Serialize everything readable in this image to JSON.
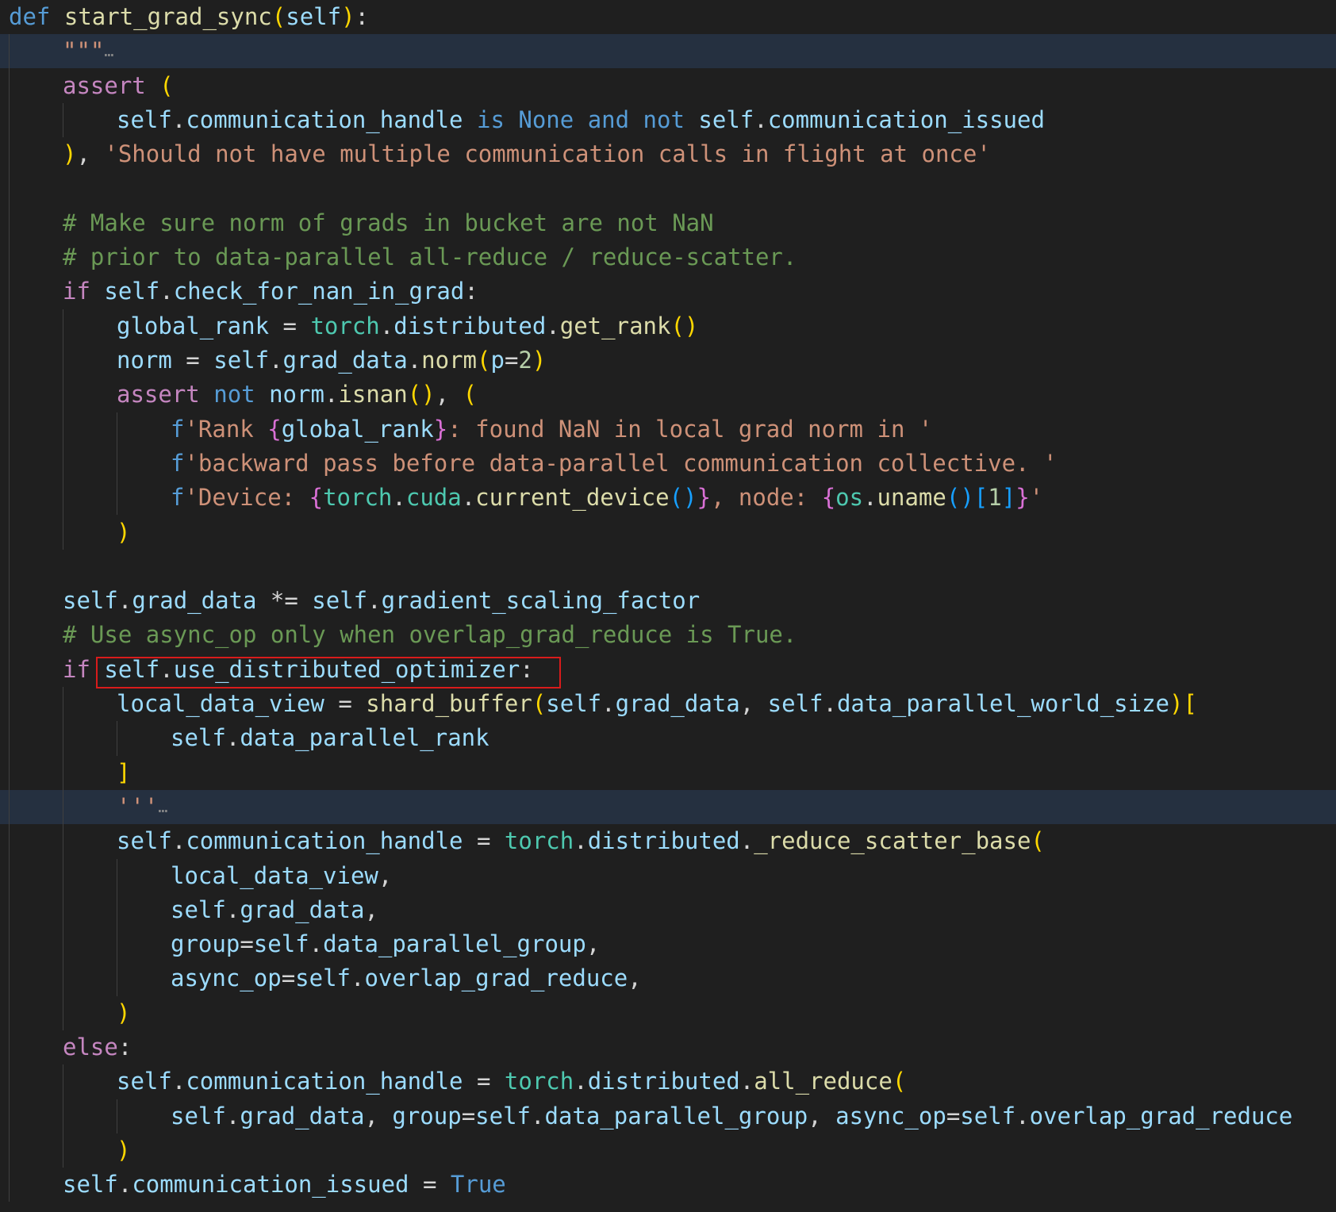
{
  "colors": {
    "background": "#1f1f1f",
    "folded_line": "#253040",
    "indent_guide": "#404040",
    "highlight_box": "#d81b1b",
    "k": "#569cd6",
    "c": "#c586c0",
    "f": "#dcdcaa",
    "v": "#9cdcfe",
    "s": "#ce9178",
    "m": "#6a9955",
    "t": "#4ec9b0",
    "n": "#b5cea8",
    "o": "#d4d4d4",
    "p1": "#ffd700",
    "p2": "#da70d6",
    "p3": "#179fff",
    "x": "#8a8a8a"
  },
  "code_lines": [
    {
      "indent": 0,
      "tokens": [
        [
          "k",
          "def"
        ],
        [
          "o",
          " "
        ],
        [
          "f",
          "start_grad_sync"
        ],
        [
          "p1",
          "("
        ],
        [
          "v",
          "self"
        ],
        [
          "p1",
          ")"
        ],
        [
          "o",
          ":"
        ]
      ]
    },
    {
      "indent": 1,
      "folded": true,
      "tokens": [
        [
          "s",
          "\"\"\""
        ],
        [
          "x",
          "…"
        ]
      ]
    },
    {
      "indent": 1,
      "tokens": [
        [
          "c",
          "assert"
        ],
        [
          "o",
          " "
        ],
        [
          "p1",
          "("
        ]
      ]
    },
    {
      "indent": 2,
      "tokens": [
        [
          "v",
          "self"
        ],
        [
          "o",
          "."
        ],
        [
          "v",
          "communication_handle"
        ],
        [
          "o",
          " "
        ],
        [
          "k",
          "is"
        ],
        [
          "o",
          " "
        ],
        [
          "k",
          "None"
        ],
        [
          "o",
          " "
        ],
        [
          "k",
          "and"
        ],
        [
          "o",
          " "
        ],
        [
          "k",
          "not"
        ],
        [
          "o",
          " "
        ],
        [
          "v",
          "self"
        ],
        [
          "o",
          "."
        ],
        [
          "v",
          "communication_issued"
        ]
      ]
    },
    {
      "indent": 1,
      "tokens": [
        [
          "p1",
          ")"
        ],
        [
          "o",
          ", "
        ],
        [
          "s",
          "'Should not have multiple communication calls in flight at once'"
        ]
      ]
    },
    {
      "indent": 0,
      "tokens": []
    },
    {
      "indent": 1,
      "tokens": [
        [
          "m",
          "# Make sure norm of grads in bucket are not NaN"
        ]
      ]
    },
    {
      "indent": 1,
      "tokens": [
        [
          "m",
          "# prior to data-parallel all-reduce / reduce-scatter."
        ]
      ]
    },
    {
      "indent": 1,
      "tokens": [
        [
          "c",
          "if"
        ],
        [
          "o",
          " "
        ],
        [
          "v",
          "self"
        ],
        [
          "o",
          "."
        ],
        [
          "v",
          "check_for_nan_in_grad"
        ],
        [
          "o",
          ":"
        ]
      ]
    },
    {
      "indent": 2,
      "tokens": [
        [
          "v",
          "global_rank"
        ],
        [
          "o",
          " = "
        ],
        [
          "t",
          "torch"
        ],
        [
          "o",
          "."
        ],
        [
          "v",
          "distributed"
        ],
        [
          "o",
          "."
        ],
        [
          "f",
          "get_rank"
        ],
        [
          "p1",
          "()"
        ]
      ]
    },
    {
      "indent": 2,
      "tokens": [
        [
          "v",
          "norm"
        ],
        [
          "o",
          " = "
        ],
        [
          "v",
          "self"
        ],
        [
          "o",
          "."
        ],
        [
          "v",
          "grad_data"
        ],
        [
          "o",
          "."
        ],
        [
          "f",
          "norm"
        ],
        [
          "p1",
          "("
        ],
        [
          "v",
          "p"
        ],
        [
          "o",
          "="
        ],
        [
          "n",
          "2"
        ],
        [
          "p1",
          ")"
        ]
      ]
    },
    {
      "indent": 2,
      "tokens": [
        [
          "c",
          "assert"
        ],
        [
          "o",
          " "
        ],
        [
          "k",
          "not"
        ],
        [
          "o",
          " "
        ],
        [
          "v",
          "norm"
        ],
        [
          "o",
          "."
        ],
        [
          "f",
          "isnan"
        ],
        [
          "p1",
          "()"
        ],
        [
          "o",
          ", "
        ],
        [
          "p1",
          "("
        ]
      ]
    },
    {
      "indent": 3,
      "tokens": [
        [
          "k",
          "f"
        ],
        [
          "s",
          "'Rank "
        ],
        [
          "p2",
          "{"
        ],
        [
          "v",
          "global_rank"
        ],
        [
          "p2",
          "}"
        ],
        [
          "s",
          ": found NaN in local grad norm in '"
        ]
      ]
    },
    {
      "indent": 3,
      "tokens": [
        [
          "k",
          "f"
        ],
        [
          "s",
          "'backward pass before data-parallel communication collective. '"
        ]
      ]
    },
    {
      "indent": 3,
      "tokens": [
        [
          "k",
          "f"
        ],
        [
          "s",
          "'Device: "
        ],
        [
          "p2",
          "{"
        ],
        [
          "t",
          "torch"
        ],
        [
          "o",
          "."
        ],
        [
          "t",
          "cuda"
        ],
        [
          "o",
          "."
        ],
        [
          "f",
          "current_device"
        ],
        [
          "p3",
          "()"
        ],
        [
          "p2",
          "}"
        ],
        [
          "s",
          ", node: "
        ],
        [
          "p2",
          "{"
        ],
        [
          "t",
          "os"
        ],
        [
          "o",
          "."
        ],
        [
          "f",
          "uname"
        ],
        [
          "p3",
          "()"
        ],
        [
          "p3",
          "["
        ],
        [
          "n",
          "1"
        ],
        [
          "p3",
          "]"
        ],
        [
          "p2",
          "}"
        ],
        [
          "s",
          "'"
        ]
      ]
    },
    {
      "indent": 2,
      "tokens": [
        [
          "p1",
          ")"
        ]
      ]
    },
    {
      "indent": 0,
      "tokens": []
    },
    {
      "indent": 1,
      "tokens": [
        [
          "v",
          "self"
        ],
        [
          "o",
          "."
        ],
        [
          "v",
          "grad_data"
        ],
        [
          "o",
          " *= "
        ],
        [
          "v",
          "self"
        ],
        [
          "o",
          "."
        ],
        [
          "v",
          "gradient_scaling_factor"
        ]
      ]
    },
    {
      "indent": 1,
      "tokens": [
        [
          "m",
          "# Use async_op only when overlap_grad_reduce is True."
        ]
      ]
    },
    {
      "indent": 1,
      "tokens": [
        [
          "c",
          "if"
        ],
        [
          "o",
          " "
        ],
        [
          "v",
          "self"
        ],
        [
          "o",
          "."
        ],
        [
          "v",
          "use_distributed_optimizer"
        ],
        [
          "o",
          ":"
        ]
      ]
    },
    {
      "indent": 2,
      "tokens": [
        [
          "v",
          "local_data_view"
        ],
        [
          "o",
          " = "
        ],
        [
          "f",
          "shard_buffer"
        ],
        [
          "p1",
          "("
        ],
        [
          "v",
          "self"
        ],
        [
          "o",
          "."
        ],
        [
          "v",
          "grad_data"
        ],
        [
          "o",
          ", "
        ],
        [
          "v",
          "self"
        ],
        [
          "o",
          "."
        ],
        [
          "v",
          "data_parallel_world_size"
        ],
        [
          "p1",
          ")"
        ],
        [
          "p1",
          "["
        ]
      ]
    },
    {
      "indent": 3,
      "tokens": [
        [
          "v",
          "self"
        ],
        [
          "o",
          "."
        ],
        [
          "v",
          "data_parallel_rank"
        ]
      ]
    },
    {
      "indent": 2,
      "tokens": [
        [
          "p1",
          "]"
        ]
      ]
    },
    {
      "indent": 2,
      "folded": true,
      "tokens": [
        [
          "s",
          "'''"
        ],
        [
          "x",
          "…"
        ]
      ]
    },
    {
      "indent": 2,
      "tokens": [
        [
          "v",
          "self"
        ],
        [
          "o",
          "."
        ],
        [
          "v",
          "communication_handle"
        ],
        [
          "o",
          " = "
        ],
        [
          "t",
          "torch"
        ],
        [
          "o",
          "."
        ],
        [
          "v",
          "distributed"
        ],
        [
          "o",
          "."
        ],
        [
          "f",
          "_reduce_scatter_base"
        ],
        [
          "p1",
          "("
        ]
      ]
    },
    {
      "indent": 3,
      "tokens": [
        [
          "v",
          "local_data_view"
        ],
        [
          "o",
          ","
        ]
      ]
    },
    {
      "indent": 3,
      "tokens": [
        [
          "v",
          "self"
        ],
        [
          "o",
          "."
        ],
        [
          "v",
          "grad_data"
        ],
        [
          "o",
          ","
        ]
      ]
    },
    {
      "indent": 3,
      "tokens": [
        [
          "v",
          "group"
        ],
        [
          "o",
          "="
        ],
        [
          "v",
          "self"
        ],
        [
          "o",
          "."
        ],
        [
          "v",
          "data_parallel_group"
        ],
        [
          "o",
          ","
        ]
      ]
    },
    {
      "indent": 3,
      "tokens": [
        [
          "v",
          "async_op"
        ],
        [
          "o",
          "="
        ],
        [
          "v",
          "self"
        ],
        [
          "o",
          "."
        ],
        [
          "v",
          "overlap_grad_reduce"
        ],
        [
          "o",
          ","
        ]
      ]
    },
    {
      "indent": 2,
      "tokens": [
        [
          "p1",
          ")"
        ]
      ]
    },
    {
      "indent": 1,
      "tokens": [
        [
          "c",
          "else"
        ],
        [
          "o",
          ":"
        ]
      ]
    },
    {
      "indent": 2,
      "tokens": [
        [
          "v",
          "self"
        ],
        [
          "o",
          "."
        ],
        [
          "v",
          "communication_handle"
        ],
        [
          "o",
          " = "
        ],
        [
          "t",
          "torch"
        ],
        [
          "o",
          "."
        ],
        [
          "v",
          "distributed"
        ],
        [
          "o",
          "."
        ],
        [
          "f",
          "all_reduce"
        ],
        [
          "p1",
          "("
        ]
      ]
    },
    {
      "indent": 3,
      "tokens": [
        [
          "v",
          "self"
        ],
        [
          "o",
          "."
        ],
        [
          "v",
          "grad_data"
        ],
        [
          "o",
          ", "
        ],
        [
          "v",
          "group"
        ],
        [
          "o",
          "="
        ],
        [
          "v",
          "self"
        ],
        [
          "o",
          "."
        ],
        [
          "v",
          "data_parallel_group"
        ],
        [
          "o",
          ", "
        ],
        [
          "v",
          "async_op"
        ],
        [
          "o",
          "="
        ],
        [
          "v",
          "self"
        ],
        [
          "o",
          "."
        ],
        [
          "v",
          "overlap_grad_reduce"
        ]
      ]
    },
    {
      "indent": 2,
      "tokens": [
        [
          "p1",
          ")"
        ]
      ]
    },
    {
      "indent": 1,
      "tokens": [
        [
          "v",
          "self"
        ],
        [
          "o",
          "."
        ],
        [
          "v",
          "communication_issued"
        ],
        [
          "o",
          " = "
        ],
        [
          "k",
          "True"
        ]
      ]
    }
  ],
  "highlighted_line": 19,
  "highlighted_text": "self.use_distributed_optimizer:"
}
